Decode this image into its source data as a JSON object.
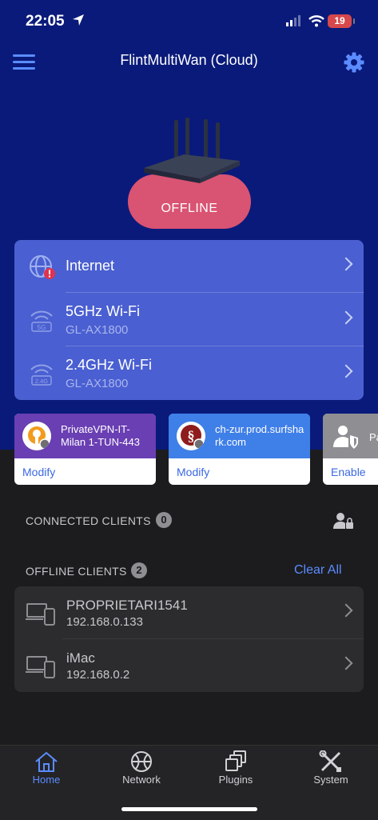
{
  "status_bar": {
    "time": "22:05",
    "battery": "19"
  },
  "header": {
    "title": "FlintMultiWan (Cloud)"
  },
  "router": {
    "status": "OFFLINE"
  },
  "network_card": {
    "rows": [
      {
        "name": "Internet",
        "sub": ""
      },
      {
        "name": "5GHz Wi-Fi",
        "sub": "GL-AX1800",
        "band": "5G"
      },
      {
        "name": "2.4GHz Wi-Fi",
        "sub": "GL-AX1800",
        "band": "2.4G"
      }
    ]
  },
  "vpn_cards": [
    {
      "title": "PrivateVPN-IT-Milan 1-TUN-443",
      "action": "Modify",
      "color": "#6a3fb3"
    },
    {
      "title": "ch-zur.prod.surfshark.com",
      "action": "Modify",
      "color": "#3f7fe8"
    },
    {
      "title": "Pa",
      "action": "Enable",
      "color": "#8e8e93"
    }
  ],
  "connected_clients": {
    "label": "CONNECTED CLIENTS",
    "count": "0"
  },
  "offline_clients": {
    "label": "OFFLINE CLIENTS",
    "count": "2",
    "clear_all": "Clear All",
    "items": [
      {
        "name": "PROPRIETARI1541",
        "ip": "192.168.0.133"
      },
      {
        "name": "iMac",
        "ip": "192.168.0.2"
      }
    ]
  },
  "tabs": [
    {
      "label": "Home",
      "active": true
    },
    {
      "label": "Network",
      "active": false
    },
    {
      "label": "Plugins",
      "active": false
    },
    {
      "label": "System",
      "active": false
    }
  ],
  "colors": {
    "accent": "#5b8cff",
    "top_background": "#0a1a7a",
    "card": "#4a5fd1",
    "offline": "#d95372"
  }
}
